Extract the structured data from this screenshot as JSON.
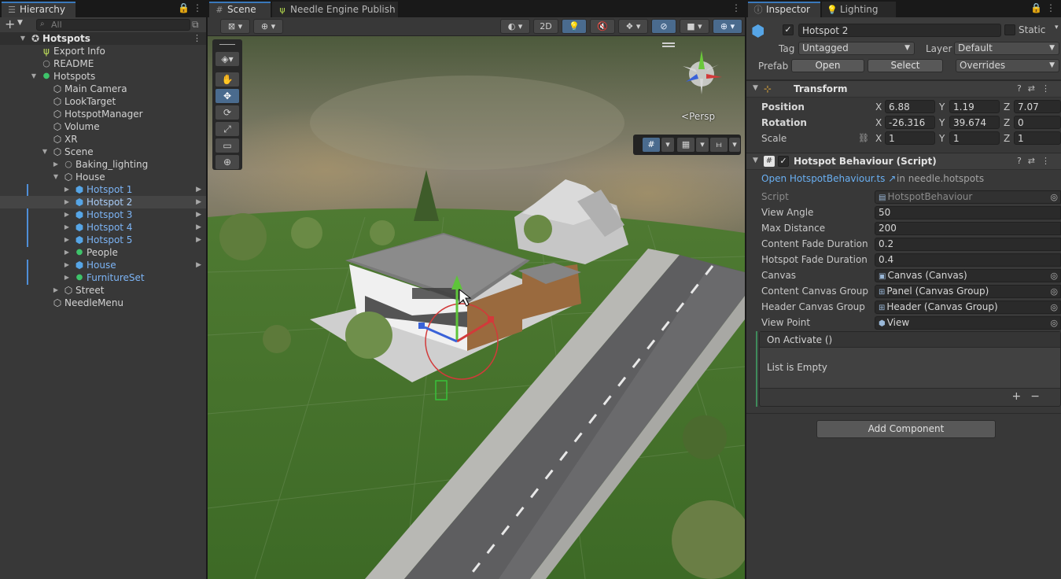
{
  "hierarchy": {
    "tab_label": "Hierarchy",
    "search_placeholder": "All",
    "items": [
      {
        "label": "Hotspots",
        "depth": 0,
        "type": "root"
      },
      {
        "label": "Export Info",
        "depth": 1,
        "type": "needle"
      },
      {
        "label": "README",
        "depth": 1,
        "type": "circle"
      },
      {
        "label": "Hotspots",
        "depth": 1,
        "type": "gdot"
      },
      {
        "label": "Main Camera",
        "depth": 2,
        "type": "cube"
      },
      {
        "label": "LookTarget",
        "depth": 2,
        "type": "cube"
      },
      {
        "label": "HotspotManager",
        "depth": 2,
        "type": "cube"
      },
      {
        "label": "Volume",
        "depth": 2,
        "type": "cube"
      },
      {
        "label": "XR",
        "depth": 2,
        "type": "cube"
      },
      {
        "label": "Scene",
        "depth": 2,
        "type": "cube"
      },
      {
        "label": "Baking_lighting",
        "depth": 3,
        "type": "circle"
      },
      {
        "label": "House",
        "depth": 3,
        "type": "cube"
      },
      {
        "label": "Hotspot 1",
        "depth": 4,
        "type": "prefab"
      },
      {
        "label": "Hotspot 2",
        "depth": 4,
        "type": "prefab"
      },
      {
        "label": "Hotspot 3",
        "depth": 4,
        "type": "prefab"
      },
      {
        "label": "Hotspot 4",
        "depth": 4,
        "type": "prefab"
      },
      {
        "label": "Hotspot 5",
        "depth": 4,
        "type": "prefab"
      },
      {
        "label": "People",
        "depth": 4,
        "type": "gdot"
      },
      {
        "label": "House",
        "depth": 4,
        "type": "prefab"
      },
      {
        "label": "FurnitureSet",
        "depth": 4,
        "type": "gdot-prefab"
      },
      {
        "label": "Street",
        "depth": 3,
        "type": "cube"
      },
      {
        "label": "NeedleMenu",
        "depth": 2,
        "type": "cube"
      }
    ]
  },
  "scene": {
    "tabs": [
      {
        "label": "Scene"
      },
      {
        "label": "Needle Engine Publish"
      }
    ],
    "toolbar_2d": "2D",
    "camera_mode": "Persp"
  },
  "inspector": {
    "tabs": [
      {
        "label": "Inspector"
      },
      {
        "label": "Lighting"
      }
    ],
    "object_name": "Hotspot 2",
    "static_label": "Static",
    "tag_label": "Tag",
    "tag_value": "Untagged",
    "layer_label": "Layer",
    "layer_value": "Default",
    "prefab_label": "Prefab",
    "prefab_open": "Open",
    "prefab_select": "Select",
    "prefab_overrides": "Overrides",
    "transform": {
      "title": "Transform",
      "position_label": "Position",
      "rotation_label": "Rotation",
      "scale_label": "Scale",
      "position": {
        "x": "6.88",
        "y": "1.19",
        "z": "7.07"
      },
      "rotation": {
        "x": "-26.316",
        "y": "39.674",
        "z": "0"
      },
      "scale": {
        "x": "1",
        "y": "1",
        "z": "1"
      },
      "axis_x": "X",
      "axis_y": "Y",
      "axis_z": "Z"
    },
    "hotspot": {
      "title": "Hotspot Behaviour (Script)",
      "open_link": "Open HotspotBehaviour.ts",
      "package": "in needle.hotspots",
      "props": [
        {
          "label": "Script",
          "value": "HotspotBehaviour"
        },
        {
          "label": "View Angle",
          "value": "50"
        },
        {
          "label": "Max Distance",
          "value": "200"
        },
        {
          "label": "Content Fade Duration",
          "value": "0.2"
        },
        {
          "label": "Hotspot Fade Duration",
          "value": "0.4"
        },
        {
          "label": "Canvas",
          "value": "Canvas (Canvas)"
        },
        {
          "label": "Content Canvas Group",
          "value": "Panel (Canvas Group)"
        },
        {
          "label": "Header Canvas Group",
          "value": "Header (Canvas Group)"
        },
        {
          "label": "View Point",
          "value": "View"
        }
      ],
      "event_title": "On Activate ()",
      "event_empty": "List is Empty"
    },
    "add_component": "Add Component"
  }
}
